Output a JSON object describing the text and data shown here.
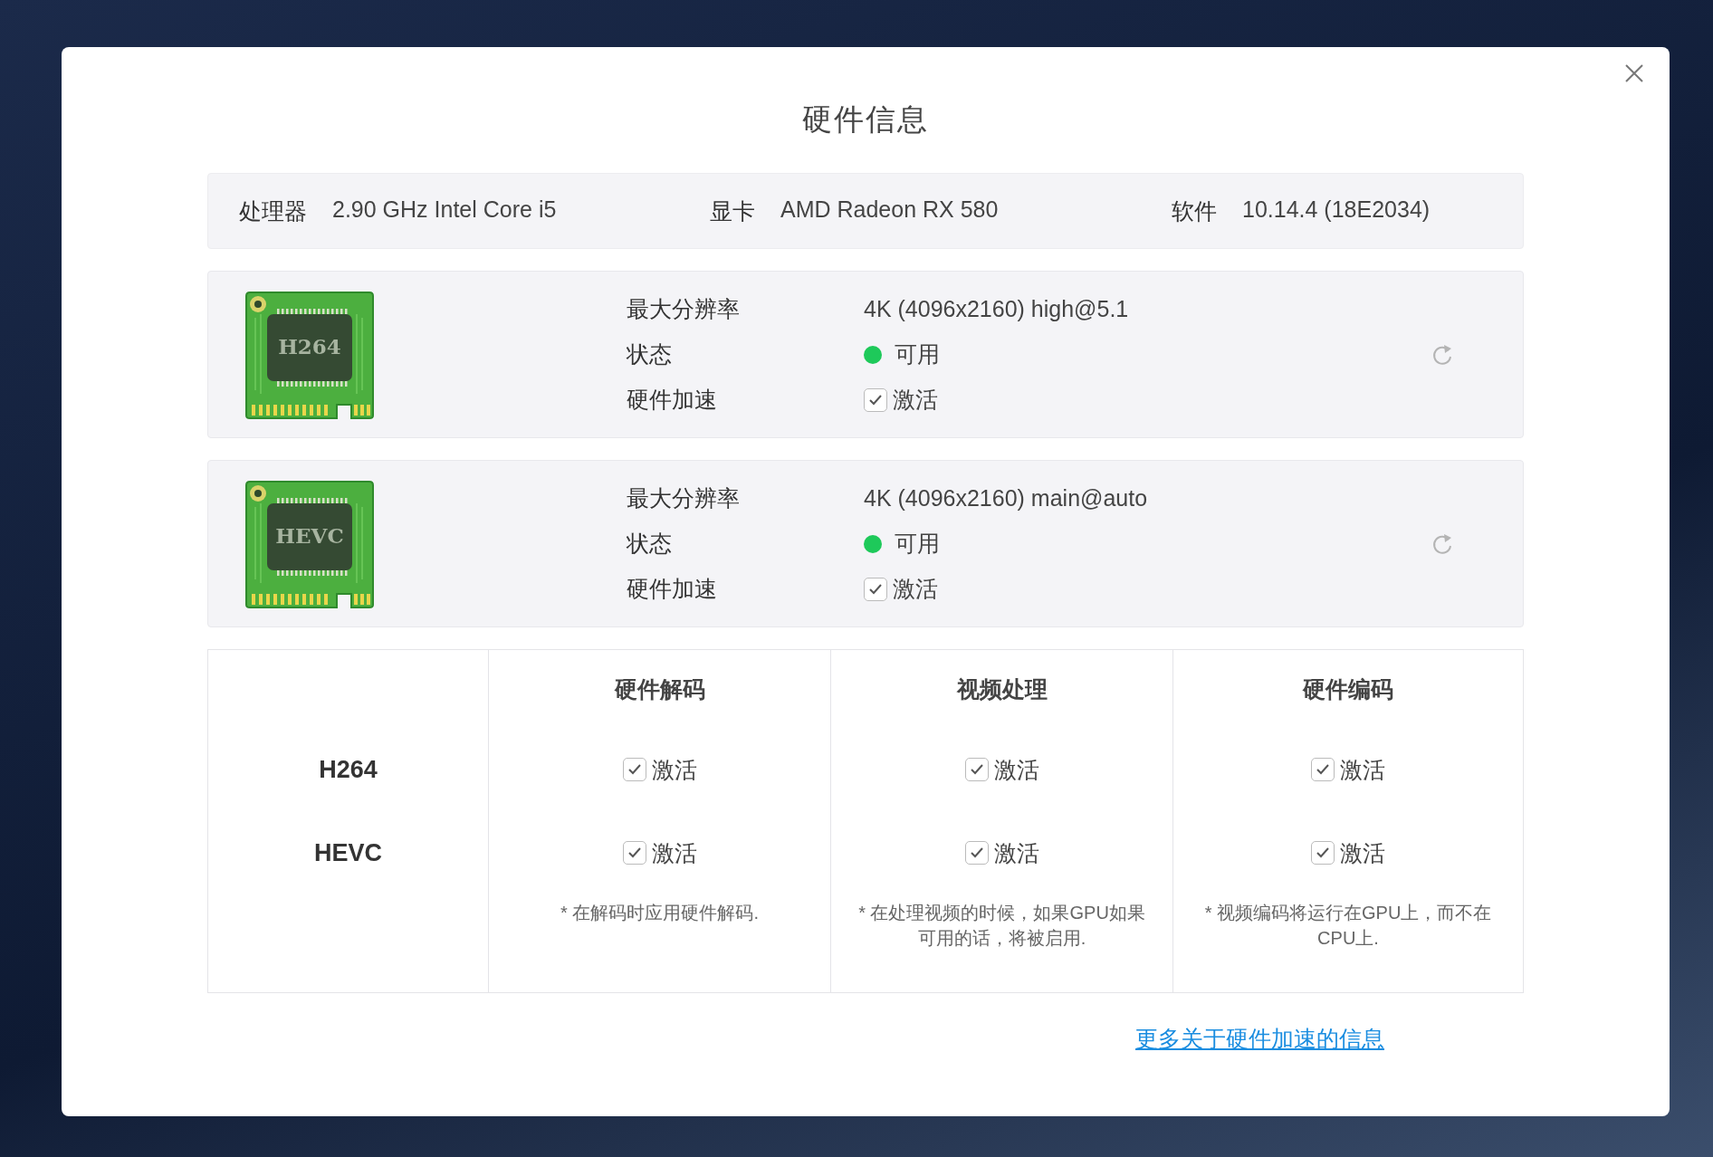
{
  "dialog": {
    "title": "硬件信息"
  },
  "summary": [
    {
      "label": "处理器",
      "value": "2.90 GHz Intel Core i5"
    },
    {
      "label": "显卡",
      "value": "AMD Radeon RX 580"
    },
    {
      "label": "软件",
      "value": "10.14.4 (18E2034)"
    }
  ],
  "codecs": [
    {
      "chip_label": "H264",
      "rows": [
        {
          "label": "最大分辨率",
          "kind": "text",
          "value": "4K (4096x2160) high@5.1"
        },
        {
          "label": "状态",
          "kind": "status",
          "value": "可用",
          "color": "#1ec95a"
        },
        {
          "label": "硬件加速",
          "kind": "checkbox",
          "value": "激活",
          "checked": true
        }
      ]
    },
    {
      "chip_label": "HEVC",
      "rows": [
        {
          "label": "最大分辨率",
          "kind": "text",
          "value": "4K (4096x2160) main@auto"
        },
        {
          "label": "状态",
          "kind": "status",
          "value": "可用",
          "color": "#1ec95a"
        },
        {
          "label": "硬件加速",
          "kind": "checkbox",
          "value": "激活",
          "checked": true
        }
      ]
    }
  ],
  "table": {
    "columns": [
      "硬件解码",
      "视频处理",
      "硬件编码"
    ],
    "rows": [
      {
        "name": "H264",
        "cells": [
          {
            "label": "激活",
            "checked": true
          },
          {
            "label": "激活",
            "checked": true
          },
          {
            "label": "激活",
            "checked": true
          }
        ]
      },
      {
        "name": "HEVC",
        "cells": [
          {
            "label": "激活",
            "checked": true
          },
          {
            "label": "激活",
            "checked": true
          },
          {
            "label": "激活",
            "checked": true
          }
        ]
      }
    ],
    "notes": [
      "* 在解码时应用硬件解码.",
      "* 在处理视频的时候，如果GPU如果可用的话，将被启用.",
      "* 视频编码将运行在GPU上，而不在CPU上."
    ]
  },
  "link": "更多关于硬件加速的信息"
}
